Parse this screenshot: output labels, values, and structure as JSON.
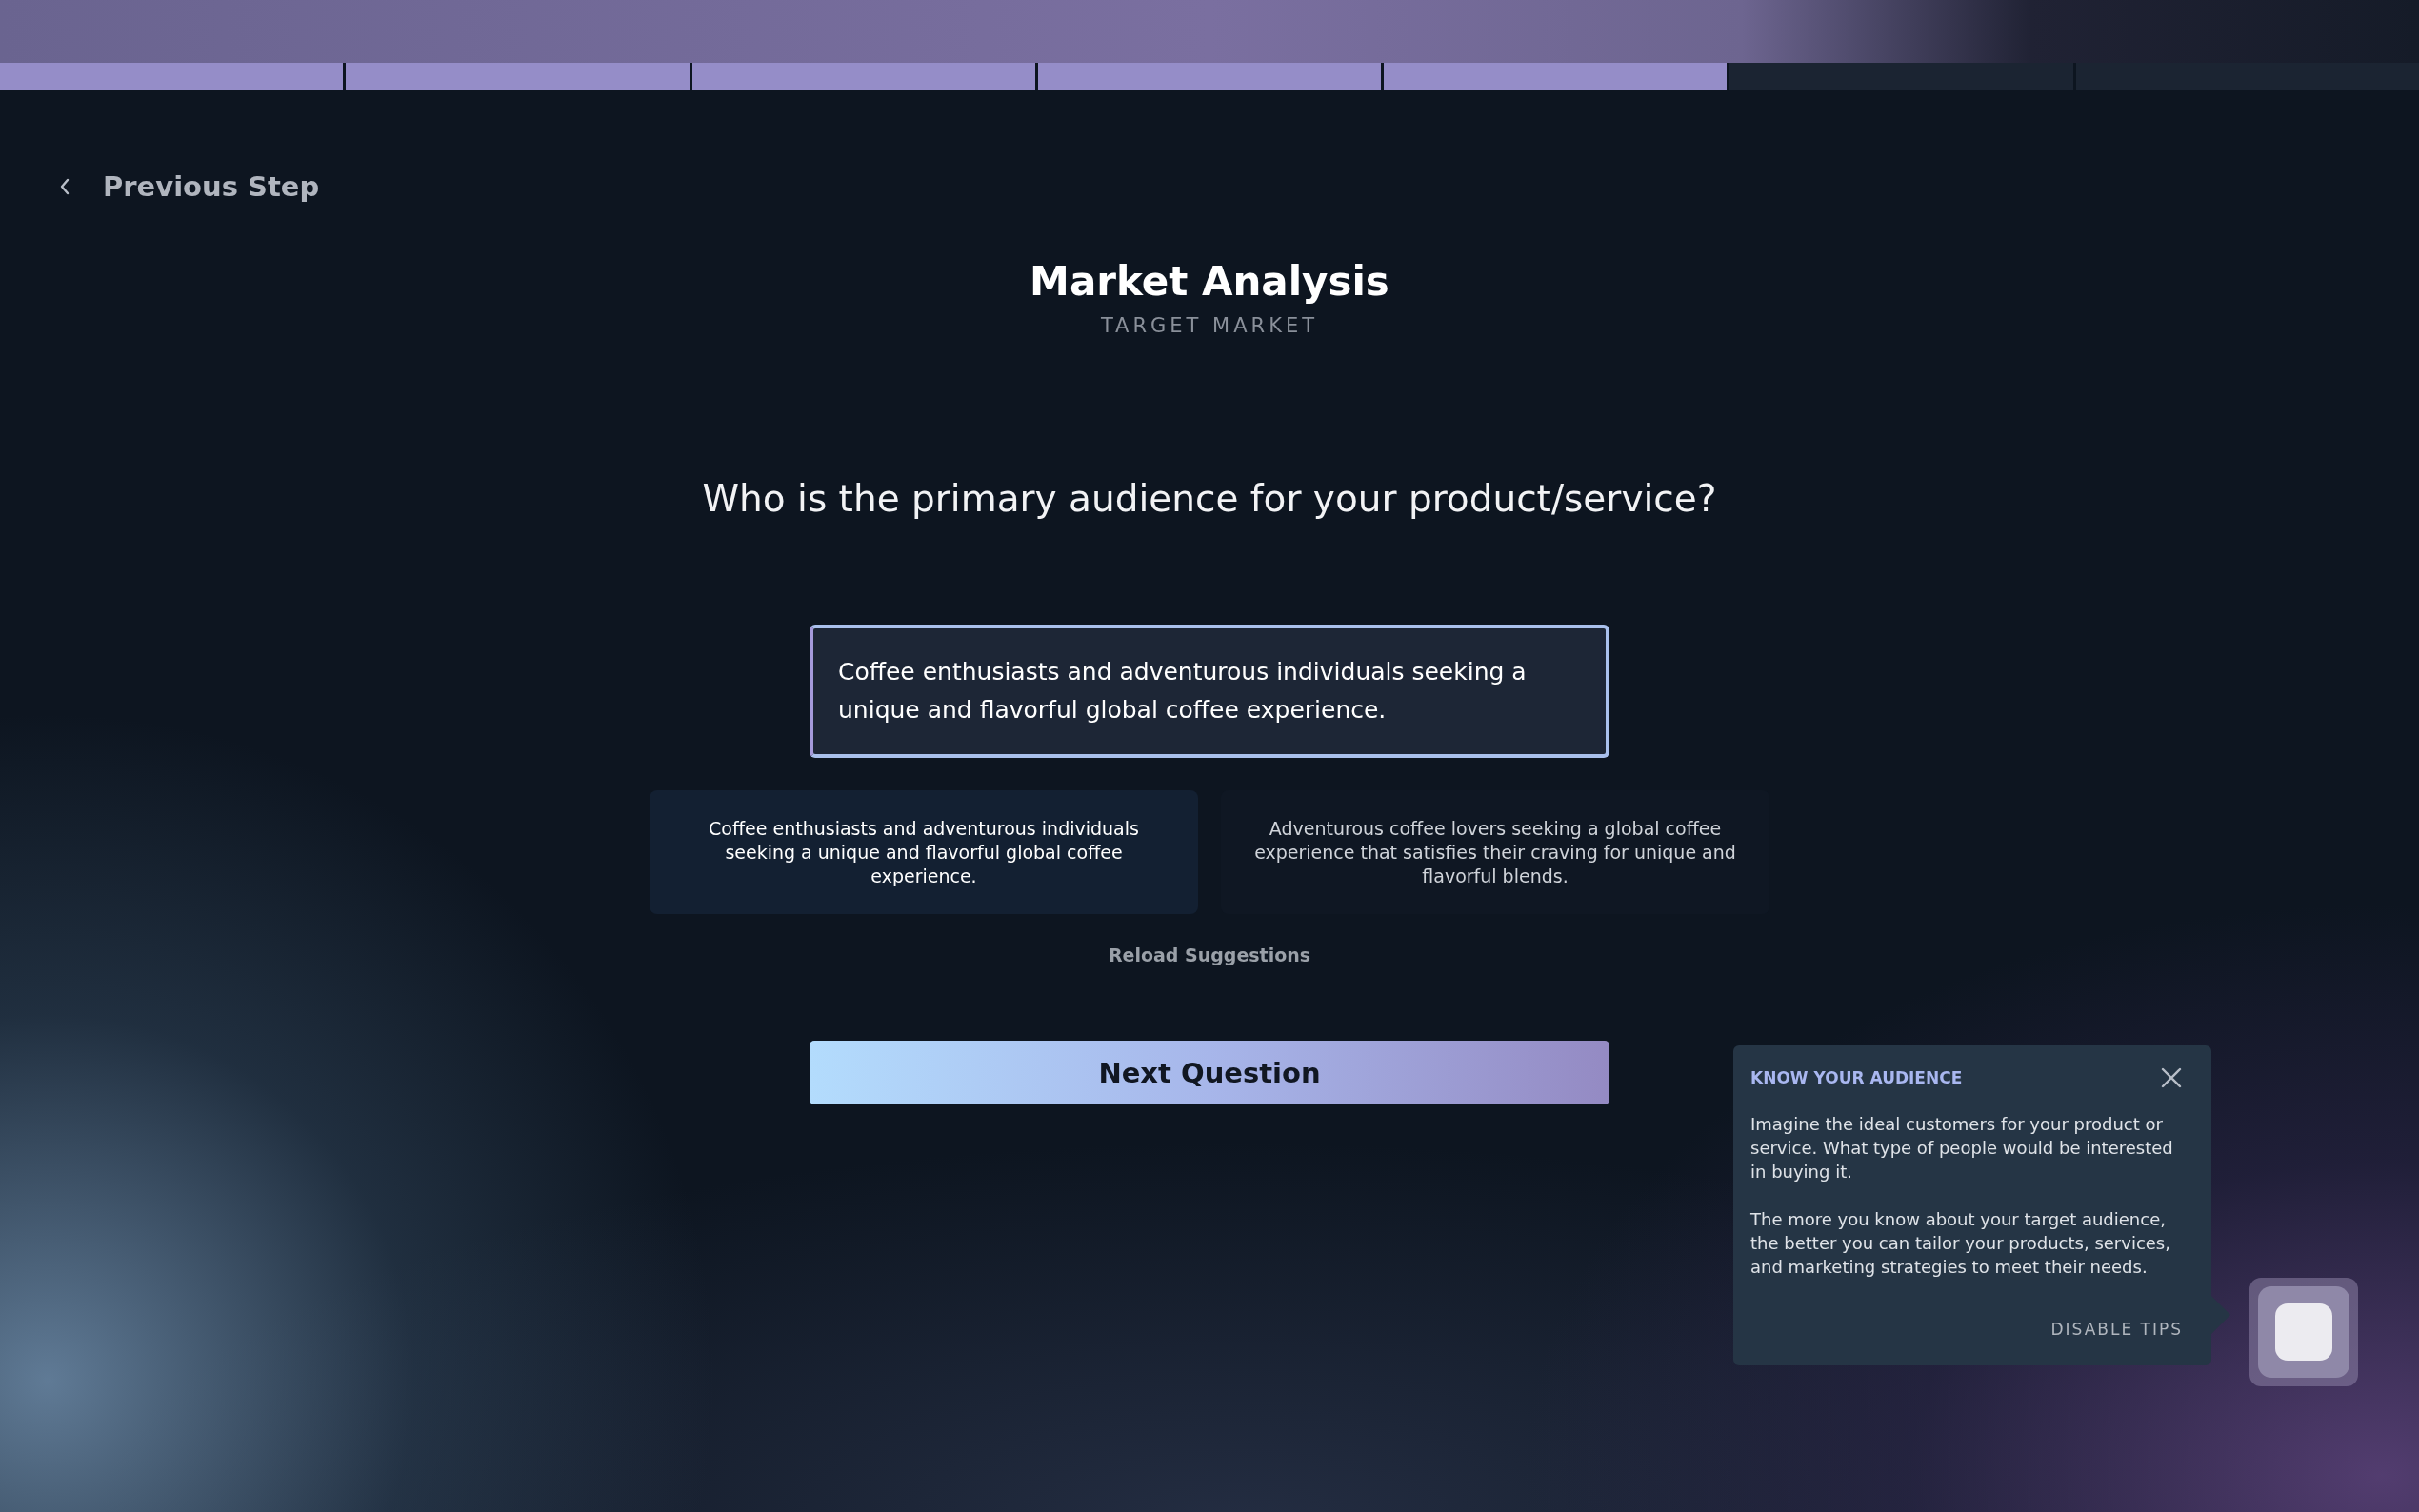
{
  "progress": {
    "segments": [
      {
        "completed": true
      },
      {
        "completed": true
      },
      {
        "completed": true
      },
      {
        "completed": true
      },
      {
        "completed": true
      },
      {
        "completed": false
      },
      {
        "completed": false
      }
    ]
  },
  "back_link": {
    "label": "Previous Step"
  },
  "header": {
    "title": "Market Analysis",
    "subtitle": "TARGET MARKET"
  },
  "question": "Who is the primary audience for your product/service?",
  "answer": {
    "value": "Coffee enthusiasts and adventurous individuals seeking a unique and flavorful global coffee experience."
  },
  "suggestions": [
    {
      "text": "Coffee enthusiasts and adventurous individuals seeking a unique and flavorful global coffee experience.",
      "selected": true
    },
    {
      "text": "Adventurous coffee lovers seeking a global coffee experience that satisfies their craving for unique and flavorful blends.",
      "selected": false
    }
  ],
  "reload_link": "Reload Suggestions",
  "next_button": "Next Question",
  "tip": {
    "title": "KNOW YOUR AUDIENCE",
    "paragraphs": [
      "Imagine the ideal customers for your product or service. What type of people would be interested in buying it.",
      "The more you know about your target audience, the better you can tailor your products, services, and marketing strategies to meet their needs."
    ],
    "action": "DISABLE TIPS"
  }
}
